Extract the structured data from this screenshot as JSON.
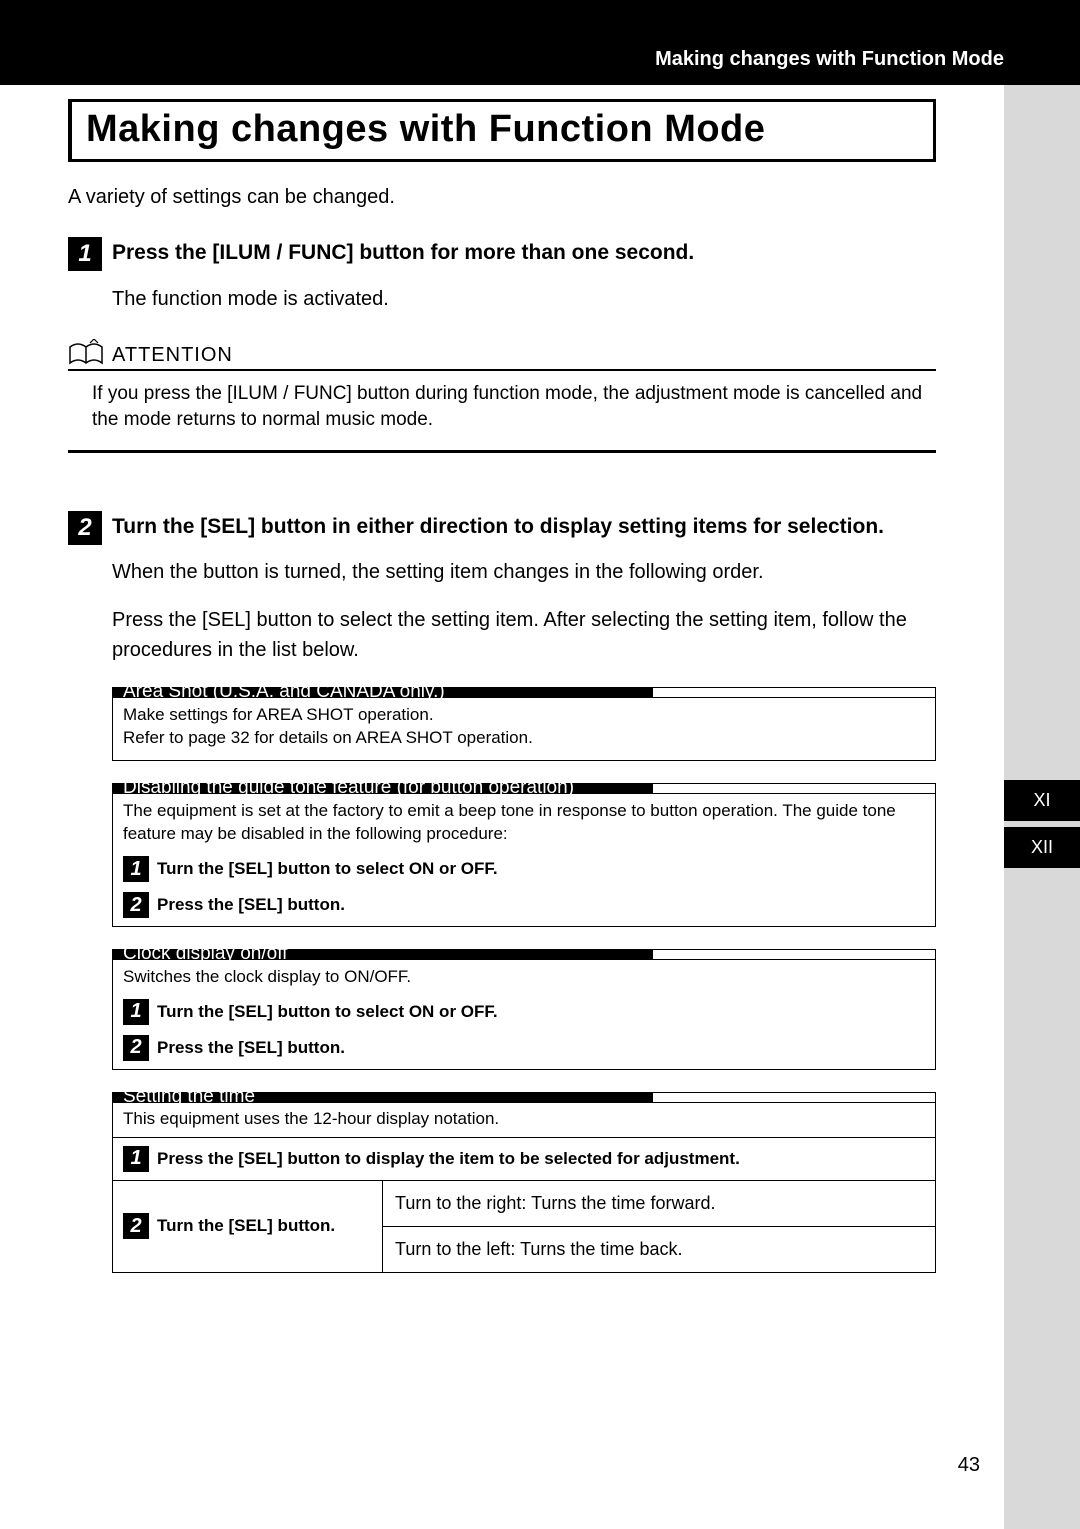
{
  "header": {
    "title": "Making changes with Function Mode"
  },
  "pageTitle": "Making changes with Function Mode",
  "intro": "A variety of settings can be changed.",
  "step1": {
    "num": "1",
    "heading": "Press the [ILUM / FUNC] button for more than one second.",
    "desc": "The function mode is activated."
  },
  "attention": {
    "label": "ATTENTION",
    "text": "If you press the [ILUM / FUNC] button during function mode, the adjustment mode is cancelled and the mode returns to normal music mode."
  },
  "step2": {
    "num": "2",
    "heading": "Turn the [SEL] button in either direction to display setting items for selection.",
    "p1": "When the button is turned, the setting item changes in the following order.",
    "p2": "Press the [SEL] button to select the setting item.  After selecting the setting item, follow the procedures in the list below."
  },
  "boxAreaShot": {
    "title": "Area Shot (U.S.A. and CANADA only.)",
    "line1": "Make settings for AREA SHOT operation.",
    "line2": "Refer to page 32 for details on AREA SHOT operation."
  },
  "boxGuideTone": {
    "title": "Disabling the guide tone feature (for button operation)",
    "desc": "The equipment is set at the factory to emit a beep tone in response to button operation. The guide tone feature may be disabled in the following procedure:",
    "s1num": "1",
    "s1": "Turn the [SEL] button to select ON or OFF.",
    "s2num": "2",
    "s2": "Press the [SEL] button."
  },
  "boxClock": {
    "title": "Clock display on/off",
    "desc": "Switches the clock display to ON/OFF.",
    "s1num": "1",
    "s1": "Turn the [SEL] button to select ON or OFF.",
    "s2num": "2",
    "s2": "Press the [SEL] button."
  },
  "boxTime": {
    "title": "Setting the time",
    "desc": "This equipment uses the 12-hour display notation.",
    "s1num": "1",
    "s1": "Press the [SEL] button to display the item to be selected for adjustment.",
    "s2num": "2",
    "s2": "Turn the [SEL] button.",
    "r1": "Turn to the right: Turns the time forward.",
    "r2": "Turn to the left: Turns the time back."
  },
  "sideTabs": {
    "t1": "XI",
    "t2": "XII"
  },
  "pageNumber": "43"
}
